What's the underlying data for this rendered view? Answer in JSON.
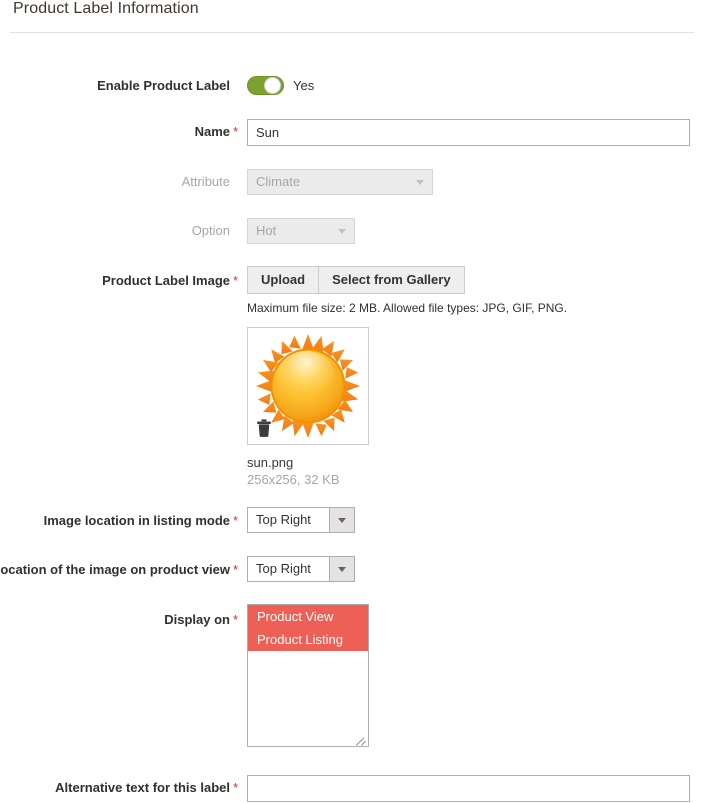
{
  "section": {
    "title": "Product Label Information"
  },
  "fields": {
    "enable": {
      "label": "Enable Product Label",
      "toggle_state": "Yes",
      "toggle_on_color": "#79a22e"
    },
    "name": {
      "label": "Name",
      "required_mark": "*",
      "value": "Sun",
      "placeholder": ""
    },
    "attribute": {
      "label": "Attribute",
      "value": "Climate",
      "disabled": true
    },
    "option": {
      "label": "Option",
      "value": "Hot",
      "disabled": true
    },
    "product_label_image": {
      "label": "Product Label Image",
      "required_mark": "*",
      "upload_label": "Upload",
      "gallery_label": "Select from Gallery",
      "note": "Maximum file size: 2 MB. Allowed file types: JPG, GIF, PNG.",
      "file_name": "sun.png",
      "file_meta": "256x256, 32 KB",
      "delete_icon": "trash-icon",
      "preview_icon": "sun-image"
    },
    "listing_location": {
      "label": "Image location in listing mode",
      "required_mark": "*",
      "value": "Top Right"
    },
    "product_view_location": {
      "label": "Location of the image on product view",
      "required_mark": "*",
      "value": "Top Right"
    },
    "display_on": {
      "label": "Display on",
      "required_mark": "*",
      "options": [
        {
          "label": "Product View",
          "selected": true
        },
        {
          "label": "Product Listing",
          "selected": true
        }
      ],
      "selected_color": "#ee5f56"
    },
    "alt_text": {
      "label": "Alternative text for this label",
      "required_mark": "*",
      "value": "",
      "placeholder": ""
    }
  }
}
